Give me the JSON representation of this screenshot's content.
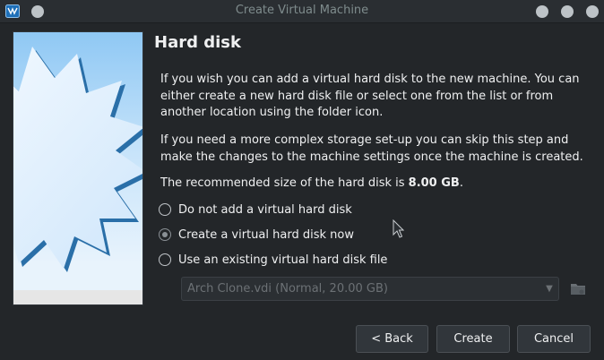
{
  "window": {
    "title": "Create Virtual Machine"
  },
  "page": {
    "heading": "Hard disk",
    "paragraph1": "If you wish you can add a virtual hard disk to the new machine. You can either create a new hard disk file or select one from the list or from another location using the folder icon.",
    "paragraph2": "If you need a more complex storage set-up you can skip this step and make the changes to the machine settings once the machine is created.",
    "recommended_prefix": "The recommended size of the hard disk is ",
    "recommended_size": "8.00 GB",
    "recommended_suffix": "."
  },
  "options": [
    {
      "label": "Do not add a virtual hard disk",
      "checked": false
    },
    {
      "label": "Create a virtual hard disk now",
      "checked": true
    },
    {
      "label": "Use an existing virtual hard disk file",
      "checked": false
    }
  ],
  "disk_selector": {
    "selected": "Arch Clone.vdi (Normal, 20.00 GB)",
    "enabled": false
  },
  "buttons": {
    "back": "< Back",
    "create": "Create",
    "cancel": "Cancel"
  },
  "icons": {
    "app": "virtualbox-icon",
    "window_buttons": [
      "minimize-icon",
      "maximize-icon",
      "close-icon"
    ],
    "folder": "folder-icon"
  },
  "colors": {
    "background": "#232629",
    "text": "#eff0f1",
    "disabled_text": "#6c7175"
  }
}
